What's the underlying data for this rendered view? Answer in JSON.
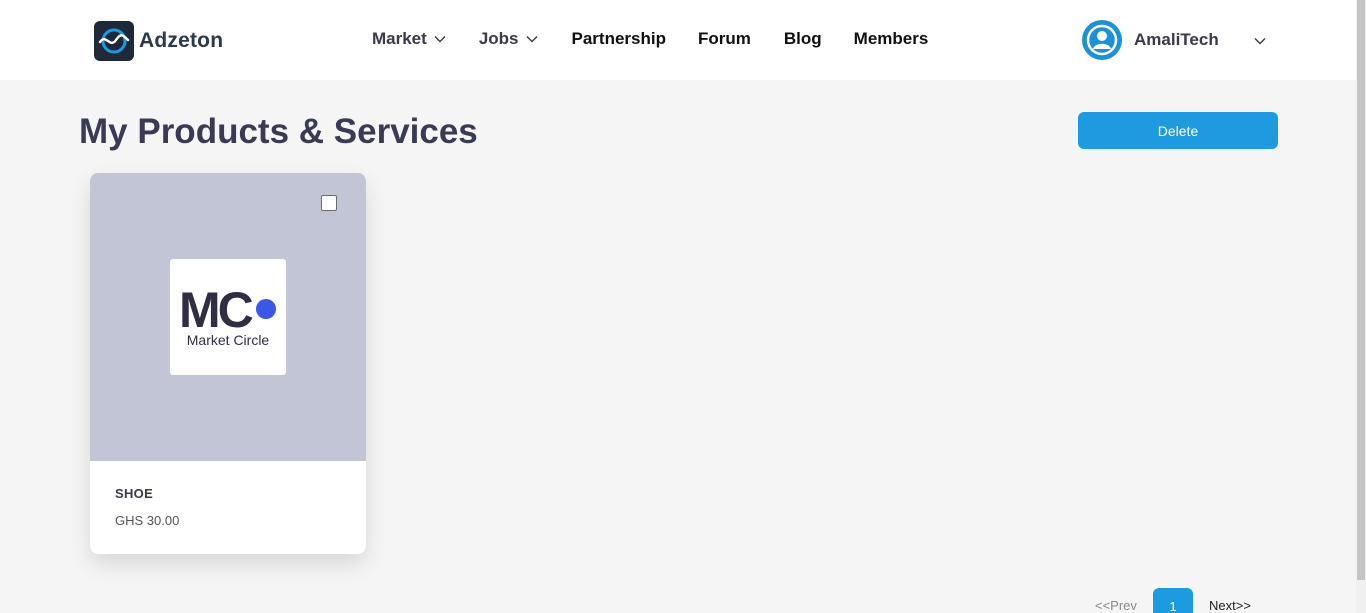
{
  "brand": {
    "name": "Adzeton",
    "icon": "adzeton-logo-icon"
  },
  "nav": {
    "market": "Market",
    "jobs": "Jobs",
    "partnership": "Partnership",
    "forum": "Forum",
    "blog": "Blog",
    "members": "Members"
  },
  "account": {
    "name": "AmaliTech",
    "icon": "user-avatar-icon"
  },
  "page": {
    "title": "My Products & Services",
    "delete_label": "Delete"
  },
  "products": [
    {
      "logo_letters": "MC",
      "logo_text": "Market Circle",
      "title": "SHOE",
      "price": "GHS 30.00",
      "selected": false
    }
  ],
  "pagination": {
    "prev": "<<Prev",
    "current": "1",
    "next": "Next>>"
  },
  "colors": {
    "accent": "#1e9ae0",
    "title": "#3b3a55",
    "card_media": "#c2c5d6",
    "logo_dot": "#3a57e8"
  }
}
